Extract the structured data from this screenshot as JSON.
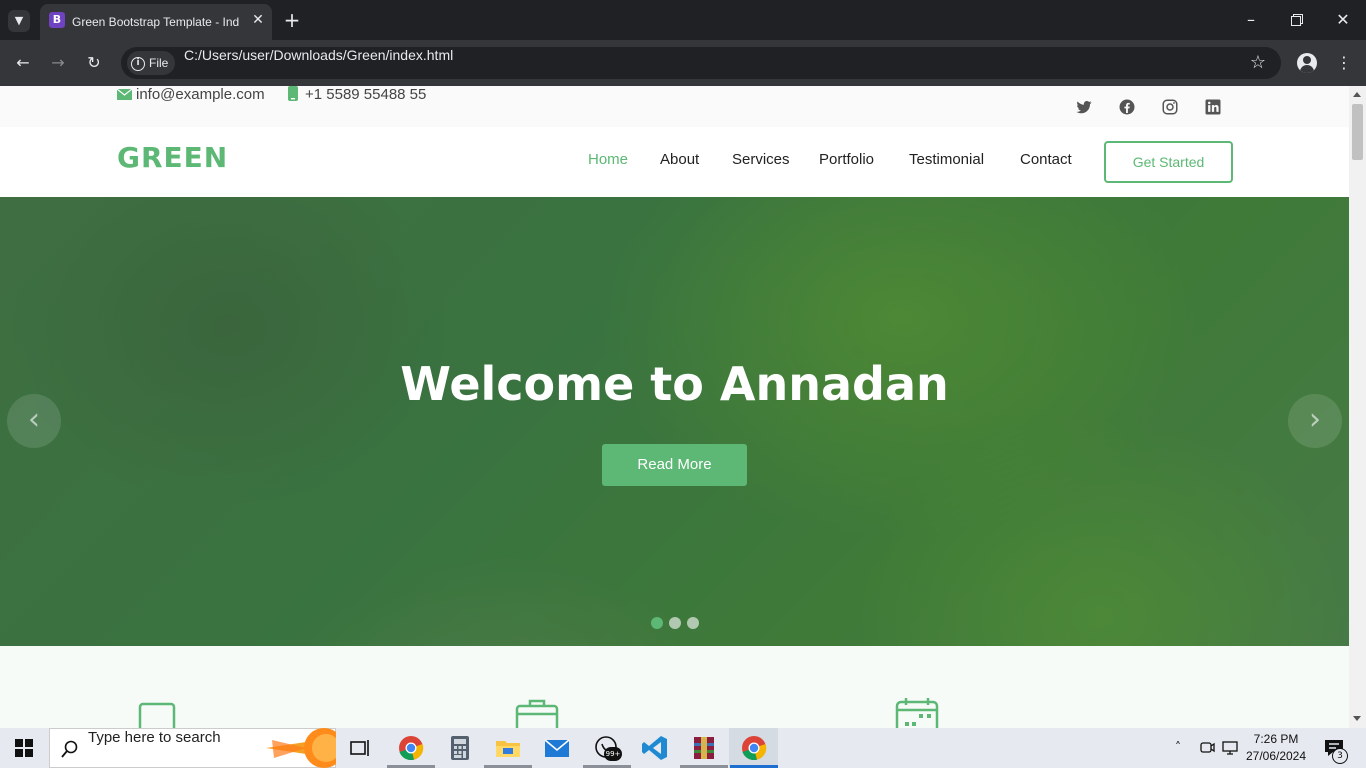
{
  "browser": {
    "tab_title": "Green Bootstrap Template - Ind",
    "tab_favicon": "B",
    "url_chip": "File",
    "url": "C:/Users/user/Downloads/Green/index.html"
  },
  "topbar": {
    "email": "info@example.com",
    "phone": "+1 5589 55488 55",
    "social_icons": [
      "twitter-icon",
      "facebook-icon",
      "instagram-icon",
      "linkedin-icon"
    ]
  },
  "header": {
    "logo": "GREEN",
    "nav": [
      "Home",
      "About",
      "Services",
      "Portfolio",
      "Testimonial",
      "Contact"
    ],
    "active_nav": "Home",
    "cta": "Get Started"
  },
  "hero": {
    "title": "Welcome to Annadan",
    "button": "Read More",
    "slides": 3,
    "active_slide": 1
  },
  "taskbar": {
    "search_placeholder": "Type here to search",
    "time": "7:26 PM",
    "date": "27/06/2024",
    "notification_count": "3",
    "badge_whatsapp": "99+"
  },
  "colors": {
    "accent": "#5cb874",
    "chrome_dark": "#202124",
    "chrome_mid": "#35363a"
  }
}
